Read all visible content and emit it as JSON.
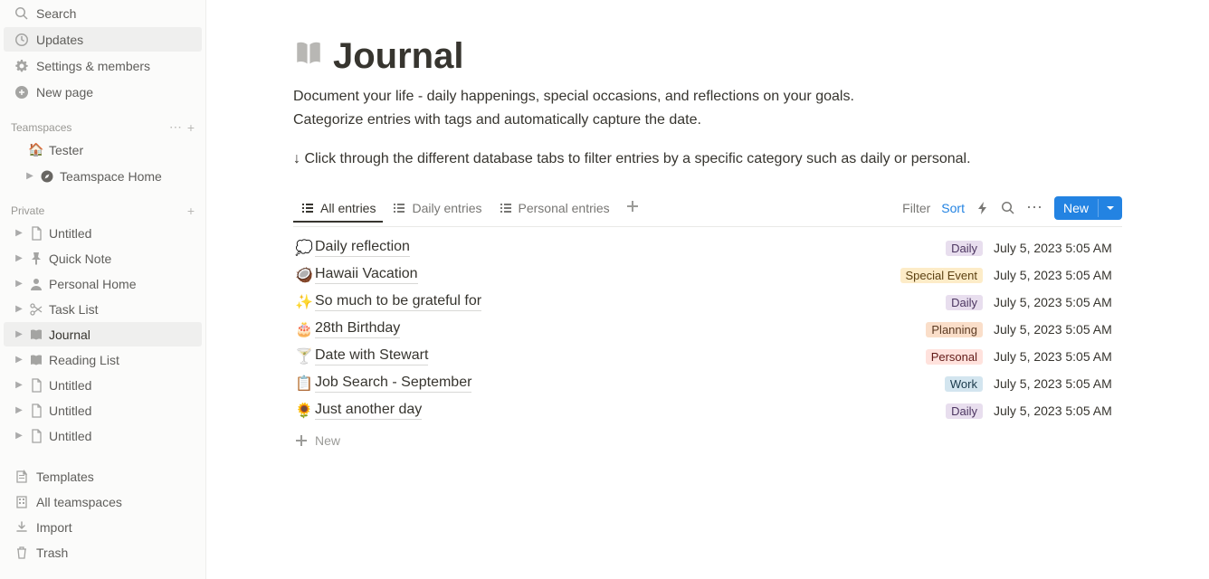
{
  "sidebar": {
    "search": "Search",
    "updates": "Updates",
    "settings": "Settings & members",
    "newpage": "New page",
    "teamspaces_label": "Teamspaces",
    "tester": "Tester",
    "teamspace_home": "Teamspace Home",
    "private_label": "Private",
    "private_pages": [
      {
        "label": "Untitled",
        "icon": "doc"
      },
      {
        "label": "Quick Note",
        "icon": "pin"
      },
      {
        "label": "Personal Home",
        "icon": "person"
      },
      {
        "label": "Task List",
        "icon": "scissors"
      },
      {
        "label": "Journal",
        "icon": "book",
        "active": true
      },
      {
        "label": "Reading List",
        "icon": "book"
      },
      {
        "label": "Untitled",
        "icon": "doc"
      },
      {
        "label": "Untitled",
        "icon": "doc"
      },
      {
        "label": "Untitled",
        "icon": "doc"
      }
    ],
    "templates": "Templates",
    "allteamspaces": "All teamspaces",
    "import": "Import",
    "trash": "Trash"
  },
  "page": {
    "title": "Journal",
    "desc1": "Document your life - daily happenings, special occasions, and reflections on your goals.",
    "desc2": "Categorize entries with tags and automatically capture the date.",
    "hint": "↓ Click through the different database tabs to filter entries by a specific category such as daily or personal."
  },
  "db": {
    "tabs": [
      {
        "label": "All entries",
        "active": true
      },
      {
        "label": "Daily entries"
      },
      {
        "label": "Personal entries"
      }
    ],
    "filter": "Filter",
    "sort": "Sort",
    "new": "New"
  },
  "entries": [
    {
      "icon": "💭",
      "title": "Daily reflection",
      "tag": "Daily",
      "tagClass": "tag-daily",
      "date": "July 5, 2023 5:05 AM"
    },
    {
      "icon": "🥥",
      "title": "Hawaii Vacation",
      "tag": "Special Event",
      "tagClass": "tag-special",
      "date": "July 5, 2023 5:05 AM"
    },
    {
      "icon": "✨",
      "title": "So much to be grateful for",
      "tag": "Daily",
      "tagClass": "tag-daily",
      "date": "July 5, 2023 5:05 AM"
    },
    {
      "icon": "🎂",
      "title": "28th Birthday",
      "tag": "Planning",
      "tagClass": "tag-planning",
      "date": "July 5, 2023 5:05 AM"
    },
    {
      "icon": "🍸",
      "title": "Date with Stewart",
      "tag": "Personal",
      "tagClass": "tag-personal",
      "date": "July 5, 2023 5:05 AM"
    },
    {
      "icon": "📋",
      "title": "Job Search - September",
      "tag": "Work",
      "tagClass": "tag-work",
      "date": "July 5, 2023 5:05 AM"
    },
    {
      "icon": "🌻",
      "title": "Just another day",
      "tag": "Daily",
      "tagClass": "tag-daily",
      "date": "July 5, 2023 5:05 AM"
    }
  ],
  "newrow": "New"
}
